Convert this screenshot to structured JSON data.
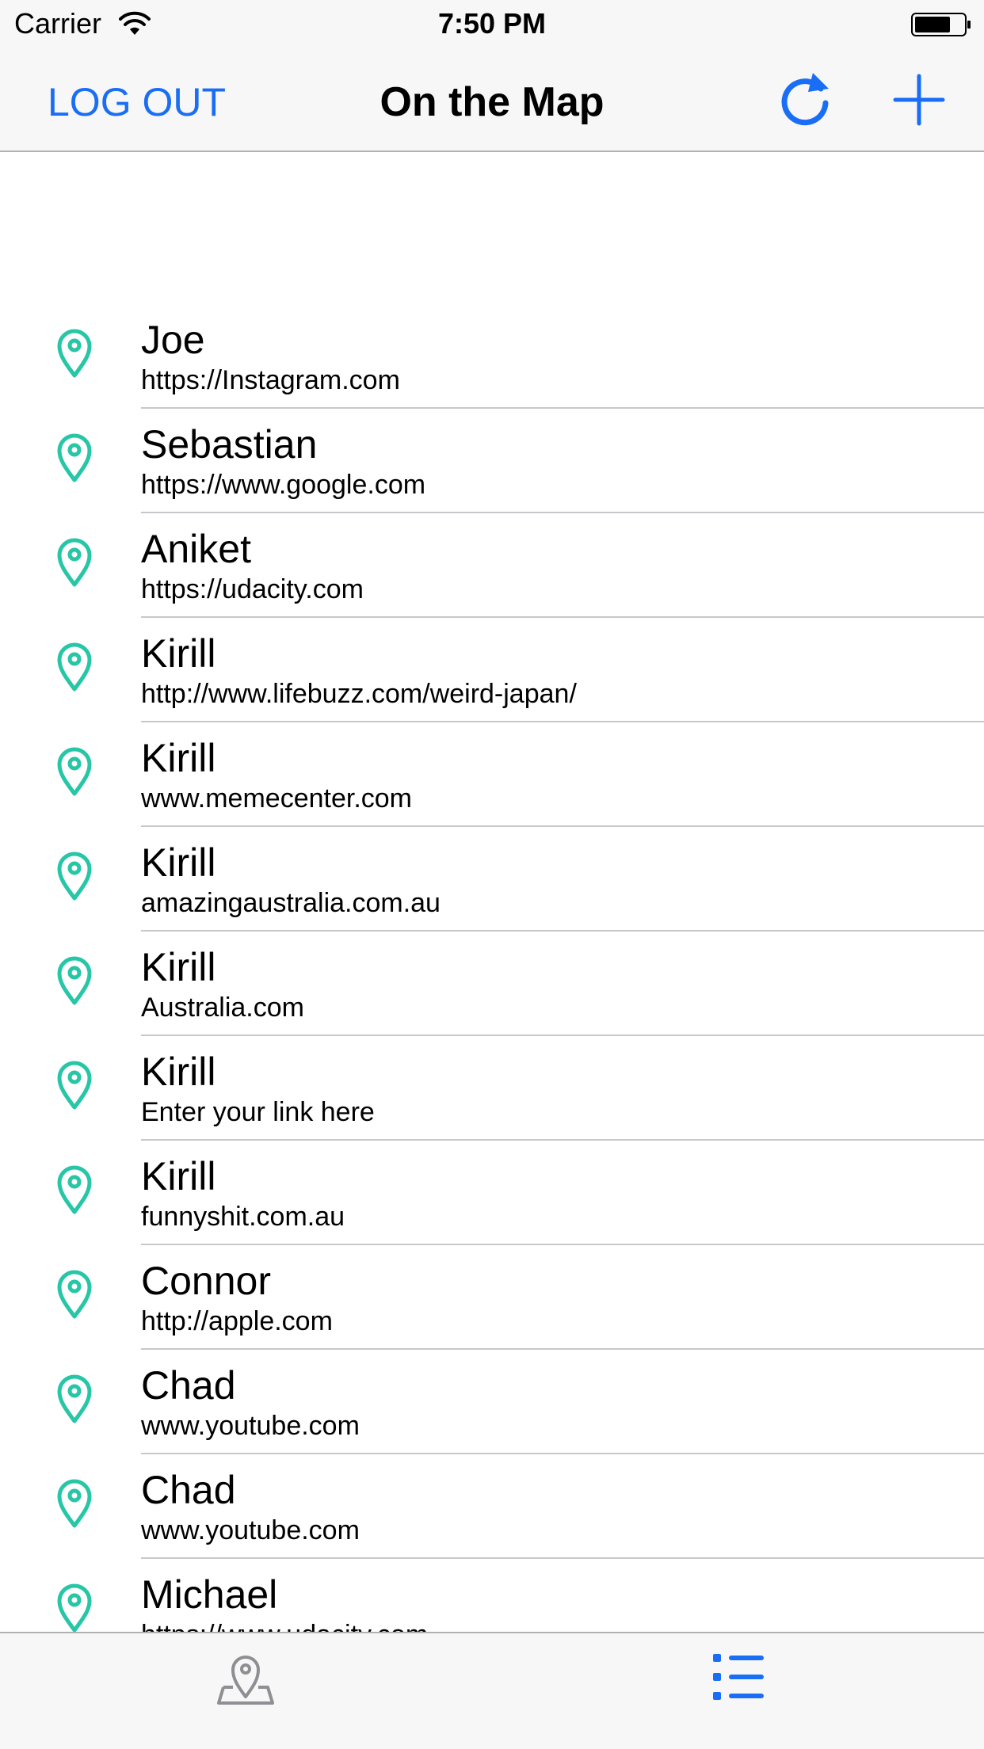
{
  "status_bar": {
    "carrier": "Carrier",
    "time": "7:50 PM",
    "wifi_icon": "wifi-icon",
    "battery_icon": "battery-icon"
  },
  "nav": {
    "logout_label": "LOG OUT",
    "title": "On the Map",
    "refresh_icon": "refresh-icon",
    "add_icon": "plus-icon"
  },
  "colors": {
    "accent": "#1a6ef5",
    "pin": "#26c6a6",
    "bar_background": "#f7f7f7",
    "separator": "#c8c7cc",
    "tab_inactive": "#8e8e93"
  },
  "students": [
    {
      "name": "Joe",
      "url": "https://Instagram.com"
    },
    {
      "name": "Sebastian",
      "url": "https://www.google.com"
    },
    {
      "name": "Aniket",
      "url": "https://udacity.com"
    },
    {
      "name": "Kirill",
      "url": "http://www.lifebuzz.com/weird-japan/"
    },
    {
      "name": "Kirill",
      "url": "www.memecenter.com"
    },
    {
      "name": "Kirill",
      "url": "amazingaustralia.com.au"
    },
    {
      "name": "Kirill",
      "url": "Australia.com"
    },
    {
      "name": "Kirill",
      "url": "Enter your link here"
    },
    {
      "name": "Kirill",
      "url": "funnyshit.com.au"
    },
    {
      "name": "Connor",
      "url": "http://apple.com"
    },
    {
      "name": "Chad",
      "url": "www.youtube.com"
    },
    {
      "name": "Chad",
      "url": "www.youtube.com"
    },
    {
      "name": "Michael",
      "url": "https://www.udacity.com"
    }
  ],
  "row_icon": "map-pin-icon",
  "tab_bar": {
    "tabs": [
      {
        "icon": "map-icon",
        "selected": false
      },
      {
        "icon": "list-icon",
        "selected": true
      }
    ]
  }
}
